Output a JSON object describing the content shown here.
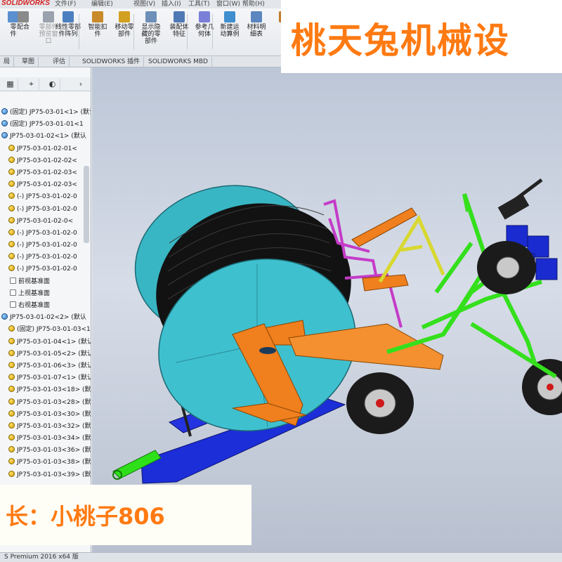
{
  "app": {
    "logo": "SOLIDWORKS",
    "menu": [
      "文件(F)",
      "编辑(E)",
      "视图(V)",
      "插入(I)",
      "工具(T)",
      "窗口(W)",
      "帮助(H)"
    ]
  },
  "ribbon": {
    "tools": [
      {
        "label": "零\n件",
        "icon": "insert-component-icon",
        "color": "#5a8fd0",
        "disabled": false
      },
      {
        "label": "配合",
        "icon": "mate-icon",
        "color": "#8a8a8a",
        "disabled": false
      },
      {
        "label": "零部件\n预览窗\n口",
        "icon": "component-preview-icon",
        "color": "#9aa3ad",
        "disabled": true
      },
      {
        "label": "线性零部\n件阵列",
        "icon": "linear-pattern-icon",
        "color": "#4c7fc0",
        "disabled": false
      },
      {
        "label": "智能扣\n件",
        "icon": "smart-fastener-icon",
        "color": "#c88a2a",
        "disabled": false
      },
      {
        "label": "移动零\n部件",
        "icon": "move-component-icon",
        "color": "#d2a020",
        "disabled": false
      },
      {
        "label": "显示隐\n藏的零\n部件",
        "icon": "show-hidden-icon",
        "color": "#6e8fb8",
        "disabled": false
      },
      {
        "label": "装配体\n特征",
        "icon": "assembly-feature-icon",
        "color": "#4e79b5",
        "disabled": false
      },
      {
        "label": "参考几\n何体",
        "icon": "reference-geometry-icon",
        "color": "#7a7fd8",
        "disabled": false
      },
      {
        "label": "新建运\n动算例",
        "icon": "motion-study-icon",
        "color": "#3f8fd0",
        "disabled": false
      },
      {
        "label": "材料明\n细表",
        "icon": "bom-icon",
        "color": "#5b86c0",
        "disabled": false
      },
      {
        "label": "爆",
        "icon": "explode-icon",
        "color": "#c07a2a",
        "disabled": false
      }
    ],
    "command_tabs": [
      "局",
      "草图",
      "评估",
      "SOLIDWORKS 插件",
      "SOLIDWORKS MBD"
    ]
  },
  "tree": {
    "toolbar": [
      "▦",
      "⌖",
      "◐"
    ],
    "items": [
      {
        "label": "(固定) JP75-03-01<1> (默认",
        "icon": "blue"
      },
      {
        "label": "(固定) JP75-03-01-01<1",
        "icon": "blue"
      },
      {
        "label": "JP75-03-01-02<1> (默认",
        "icon": "blue"
      },
      {
        "label": "JP75-03-01-02-01<",
        "icon": "part"
      },
      {
        "label": "JP75-03-01-02-02<",
        "icon": "part"
      },
      {
        "label": "JP75-03-01-02-03<",
        "icon": "part"
      },
      {
        "label": "JP75-03-01-02-03<",
        "icon": "part"
      },
      {
        "label": "(-) JP75-03-01-02-0",
        "icon": "part"
      },
      {
        "label": "(-) JP75-03-01-02-0",
        "icon": "part"
      },
      {
        "label": "JP75-03-01-02-0<",
        "icon": "part"
      },
      {
        "label": "(-) JP75-03-01-02-0",
        "icon": "part"
      },
      {
        "label": "(-) JP75-03-01-02-0",
        "icon": "part"
      },
      {
        "label": "(-) JP75-03-01-02-0",
        "icon": "part"
      },
      {
        "label": "(-) JP75-03-01-02-0",
        "icon": "part"
      },
      {
        "label": "前视基准面",
        "icon": "plane"
      },
      {
        "label": "上视基准面",
        "icon": "plane"
      },
      {
        "label": "右视基准面",
        "icon": "plane"
      },
      {
        "label": "JP75-03-01-02<2> (默认",
        "icon": "blue"
      },
      {
        "label": "(固定) JP75-03-01-03<1",
        "icon": "part"
      },
      {
        "label": "JP75-03-01-04<1> (默认",
        "icon": "part"
      },
      {
        "label": "JP75-03-01-05<2> (默认",
        "icon": "part"
      },
      {
        "label": "JP75-03-01-06<3> (默认",
        "icon": "part"
      },
      {
        "label": "JP75-03-01-07<1> (默认",
        "icon": "part"
      },
      {
        "label": "JP75-03-01-03<18> (默",
        "icon": "part"
      },
      {
        "label": "JP75-03-01-03<28> (默",
        "icon": "part"
      },
      {
        "label": "JP75-03-01-03<30> (默",
        "icon": "part"
      },
      {
        "label": "JP75-03-01-03<32> (默",
        "icon": "part"
      },
      {
        "label": "JP75-03-01-03<34> (默",
        "icon": "part"
      },
      {
        "label": "JP75-03-01-03<36> (默",
        "icon": "part"
      },
      {
        "label": "JP75-03-01-03<38> (默",
        "icon": "part"
      },
      {
        "label": "JP75-03-01-03<39> (默",
        "icon": "part"
      }
    ]
  },
  "overlay": {
    "title": "桃天兔机械设",
    "shop": "长：小桃子806"
  },
  "status": {
    "text": "S Premium 2016 x64 版"
  },
  "colors": {
    "reel": "#39b6c4",
    "frame_orange": "#f07f1e",
    "frame_blue": "#1c2ed8",
    "frame_green": "#34e01c",
    "magenta": "#c43bc8",
    "yellow": "#d8d830",
    "accent": "#ff7a12"
  }
}
